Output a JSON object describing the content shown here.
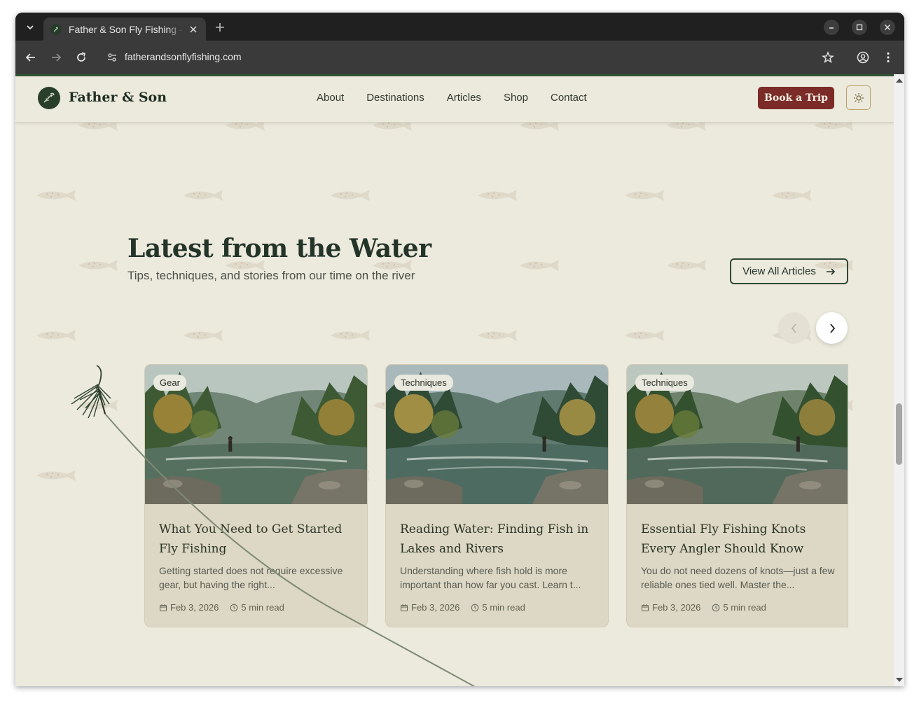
{
  "browser": {
    "tab_title": "Father & Son Fly Fishing - ",
    "url": "fatherandsonflyfishing.com"
  },
  "site": {
    "logo_text": "Father & Son",
    "nav": [
      "About",
      "Destinations",
      "Articles",
      "Shop",
      "Contact"
    ],
    "book_button": "Book a Trip",
    "theme_icon": "sun-icon"
  },
  "section": {
    "title": "Latest from the Water",
    "subtitle": "Tips, techniques, and stories from our time on the river",
    "view_all": "View All Articles"
  },
  "articles": [
    {
      "tag": "Gear",
      "title": "What You Need to Get Started Fly Fishing",
      "excerpt": "Getting started does not require excessive gear, but having the right...",
      "date": "Feb 3, 2026",
      "read_time": "5 min read"
    },
    {
      "tag": "Techniques",
      "title": "Reading Water: Finding Fish in Lakes and Rivers",
      "excerpt": "Understanding where fish hold is more important than how far you cast. Learn t...",
      "date": "Feb 3, 2026",
      "read_time": "5 min read"
    },
    {
      "tag": "Techniques",
      "title": "Essential Fly Fishing Knots Every Angler Should Know",
      "excerpt": "You do not need dozens of knots—just a few reliable ones tied well. Master the...",
      "date": "Feb 3, 2026",
      "read_time": "5 min read"
    }
  ],
  "colors": {
    "background": "#ece9dd",
    "brand_green": "#2a3e2c",
    "accent_red": "#7b2c28",
    "card_bg": "#ddd7c5"
  }
}
